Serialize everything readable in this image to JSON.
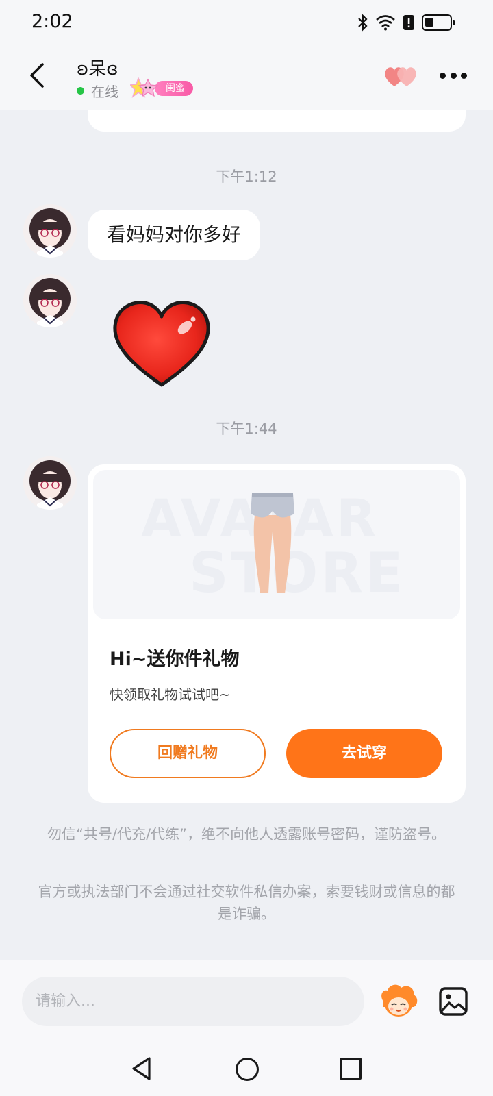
{
  "status_bar": {
    "time": "2:02",
    "icons": [
      "bluetooth-icon",
      "wifi-icon",
      "alert-icon",
      "battery-icon"
    ]
  },
  "header": {
    "contact_name": "ʚ呆ɞ",
    "online_status": "在线",
    "relation_badge": "闺蜜",
    "back_icon": "chevron-left-icon",
    "hearts_icon": "double-heart-icon",
    "more_icon": "more-dots-icon"
  },
  "chat": {
    "timestamps": [
      "下午1:12",
      "下午1:44"
    ],
    "text_message": "看妈妈对你多好",
    "sticker": "red-heart-sticker",
    "gift_card": {
      "preview_watermark_top": "AVATAR",
      "preview_watermark_bottom": "STORE",
      "title": "Hi~送你件礼物",
      "subtitle": "快领取礼物试试吧~",
      "return_button": "回赠礼物",
      "try_button": "去试穿"
    },
    "notices": [
      "勿信“共号/代充/代练”，绝不向他人透露账号密码，谨防盗号。",
      "官方或执法部门不会通过社交软件私信办案，索要钱财或信息的都是诈骗。"
    ]
  },
  "input_bar": {
    "placeholder": "请输入...",
    "emoji_icon": "emoji-mascot-icon",
    "image_icon": "image-icon"
  },
  "nav_bar": {
    "icons": [
      "nav-back-icon",
      "nav-home-icon",
      "nav-recent-icon"
    ]
  },
  "colors": {
    "accent": "#ff7418",
    "background": "#eef0f4",
    "online": "#26c547",
    "badge": "#f85aa6"
  }
}
